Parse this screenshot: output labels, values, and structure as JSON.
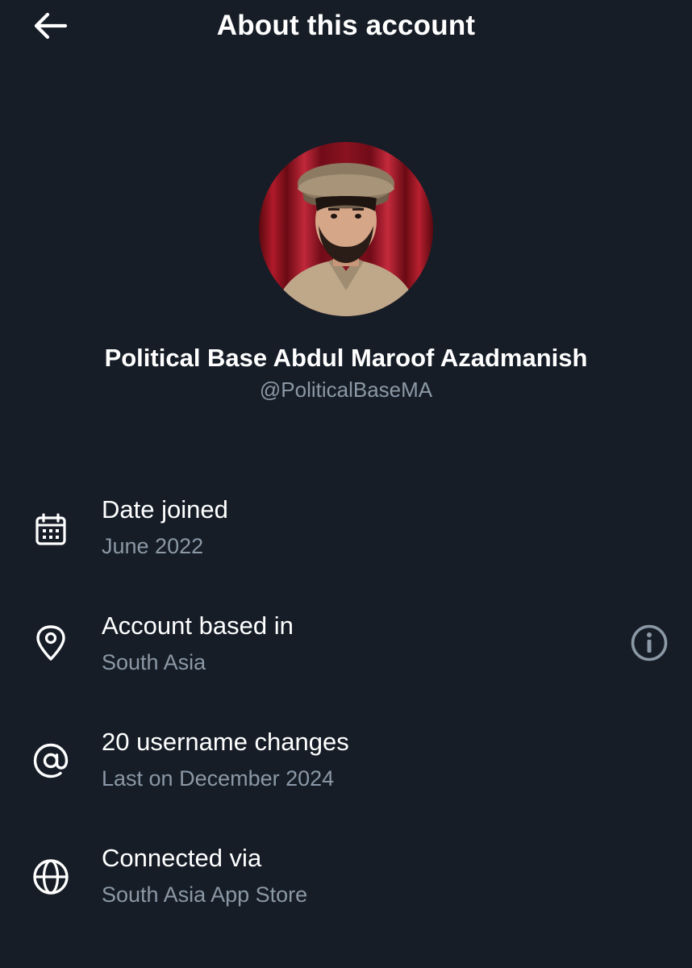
{
  "header": {
    "title": "About this account",
    "back_icon": "arrow-left-icon"
  },
  "profile": {
    "display_name": "Political Base Abdul Maroof Azadmanish",
    "handle": "@PoliticalBaseMA"
  },
  "details": [
    {
      "icon": "calendar-icon",
      "title": "Date joined",
      "subtitle": "June 2022"
    },
    {
      "icon": "location-pin-icon",
      "title": "Account based in",
      "subtitle": "South Asia",
      "action_icon": "info-icon"
    },
    {
      "icon": "at-sign-icon",
      "title": "20 username changes",
      "subtitle": "Last on December 2024"
    },
    {
      "icon": "globe-icon",
      "title": "Connected via",
      "subtitle": "South Asia App Store"
    }
  ],
  "colors": {
    "background": "#161d27",
    "primary_text": "#ffffff",
    "secondary_text": "#8b98a5"
  }
}
